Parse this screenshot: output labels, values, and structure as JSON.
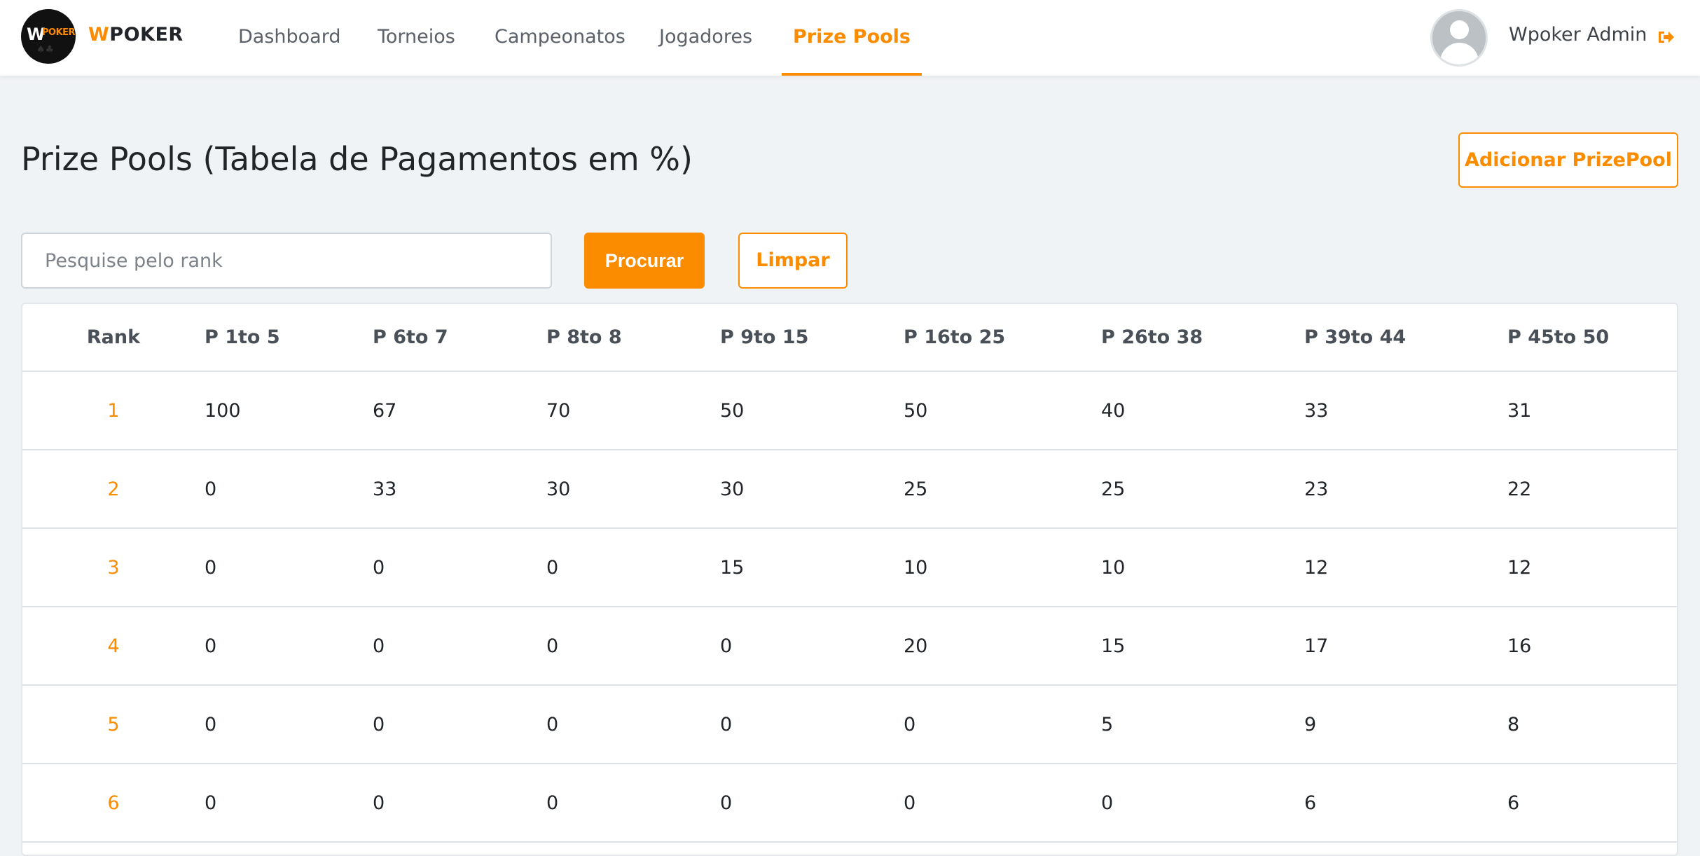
{
  "brand": {
    "logo_text_w": "W",
    "logo_text_poker": "POKER",
    "logo_subtext": "QUARTA DOS NERDS",
    "name_w": "W",
    "name_rest": "POKER"
  },
  "nav": {
    "items": [
      {
        "label": "Dashboard",
        "active": false
      },
      {
        "label": "Torneios",
        "active": false
      },
      {
        "label": "Campeonatos",
        "active": false
      },
      {
        "label": "Jogadores",
        "active": false
      },
      {
        "label": "Prize Pools",
        "active": true
      }
    ]
  },
  "user": {
    "name": "Wpoker Admin",
    "avatar_icon": "user-avatar-icon",
    "logout_icon": "sign-out-icon"
  },
  "page": {
    "title": "Prize Pools (Tabela de Pagamentos em %)",
    "add_button_label": "Adicionar PrizePool"
  },
  "search": {
    "placeholder": "Pesquise pelo rank",
    "value": "",
    "search_button_label": "Procurar",
    "clear_button_label": "Limpar"
  },
  "table": {
    "headers": [
      "Rank",
      "P 1to 5",
      "P 6to 7",
      "P 8to 8",
      "P 9to 15",
      "P 16to 25",
      "P 26to 38",
      "P 39to 44",
      "P 45to 50"
    ],
    "rows": [
      [
        "1",
        "100",
        "67",
        "70",
        "50",
        "50",
        "40",
        "33",
        "31"
      ],
      [
        "2",
        "0",
        "33",
        "30",
        "30",
        "25",
        "25",
        "23",
        "22"
      ],
      [
        "3",
        "0",
        "0",
        "0",
        "15",
        "10",
        "10",
        "12",
        "12"
      ],
      [
        "4",
        "0",
        "0",
        "0",
        "0",
        "20",
        "15",
        "17",
        "16"
      ],
      [
        "5",
        "0",
        "0",
        "0",
        "0",
        "0",
        "5",
        "9",
        "8"
      ],
      [
        "6",
        "0",
        "0",
        "0",
        "0",
        "0",
        "0",
        "6",
        "6"
      ]
    ]
  },
  "colors": {
    "accent": "#fb8c00",
    "background": "#f0f3f6",
    "text": "#212529",
    "nav_text": "#5a6169"
  }
}
